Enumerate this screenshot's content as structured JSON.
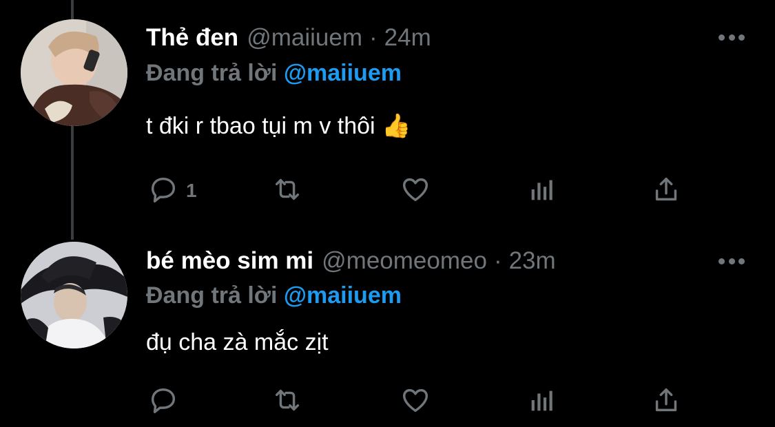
{
  "colors": {
    "background": "#000000",
    "text": "#ffffff",
    "muted": "#71767b",
    "mention": "#1d9bf0",
    "thread_line": "#3a3d40"
  },
  "tweets": [
    {
      "display_name": "Thẻ đen",
      "handle": "@maiiuem",
      "separator": "·",
      "time": "24m",
      "replying_label": "Đang trả lời",
      "replying_to": "@maiiuem",
      "text": "t đki r tbao tụi m v thôi 👍",
      "reply_count": "1",
      "icons": [
        "reply-icon",
        "retweet-icon",
        "like-icon",
        "stats-icon",
        "share-icon",
        "more-icon"
      ]
    },
    {
      "display_name": "bé mèo sim mi",
      "handle": "@meomeomeo",
      "separator": "·",
      "time": "23m",
      "replying_label": "Đang trả lời",
      "replying_to": "@maiiuem",
      "text": "đụ cha zà mắc zịt",
      "reply_count": "",
      "icons": [
        "reply-icon",
        "retweet-icon",
        "like-icon",
        "stats-icon",
        "share-icon",
        "more-icon"
      ]
    }
  ]
}
